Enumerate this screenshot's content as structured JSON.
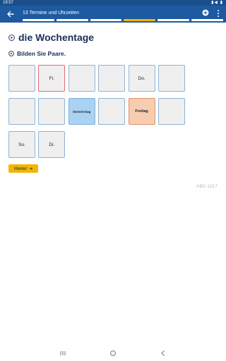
{
  "status_bar": {
    "time": "19:57",
    "icons": "▮◀ ▮"
  },
  "app_bar": {
    "title": "13 Termine und Uhrzeiten"
  },
  "progress": [
    {
      "state": "done",
      "color": "#ffffff"
    },
    {
      "state": "done",
      "color": "#ffffff"
    },
    {
      "state": "done",
      "color": "#ffffff"
    },
    {
      "state": "current",
      "color": "#f3b600"
    },
    {
      "state": "done",
      "color": "#ffffff"
    },
    {
      "state": "done",
      "color": "#ffffff"
    }
  ],
  "page": {
    "heading": "die Wochentage",
    "instruction": "Bilden Sie Paare."
  },
  "cards": [
    {
      "label": "",
      "style": "plain"
    },
    {
      "label": "Fr.",
      "style": "red"
    },
    {
      "label": "",
      "style": "plain"
    },
    {
      "label": "",
      "style": "plain"
    },
    {
      "label": "Do.",
      "style": "plain"
    },
    {
      "label": "",
      "style": "plain"
    },
    {
      "label": "",
      "style": "plain"
    },
    {
      "label": "",
      "style": "plain"
    },
    {
      "label": "Donnerstag",
      "style": "blue"
    },
    {
      "label": "",
      "style": "plain"
    },
    {
      "label": "Freitag",
      "style": "orange"
    },
    {
      "label": "",
      "style": "plain"
    },
    {
      "label": "So.",
      "style": "plain"
    },
    {
      "label": "Di.",
      "style": "plain"
    }
  ],
  "next_button": {
    "label": "Weiter"
  },
  "code_label": "ABC-1317",
  "colors": {
    "appbar": "#1d5aa1",
    "accent": "#f3b600",
    "heading": "#1b2f56"
  }
}
